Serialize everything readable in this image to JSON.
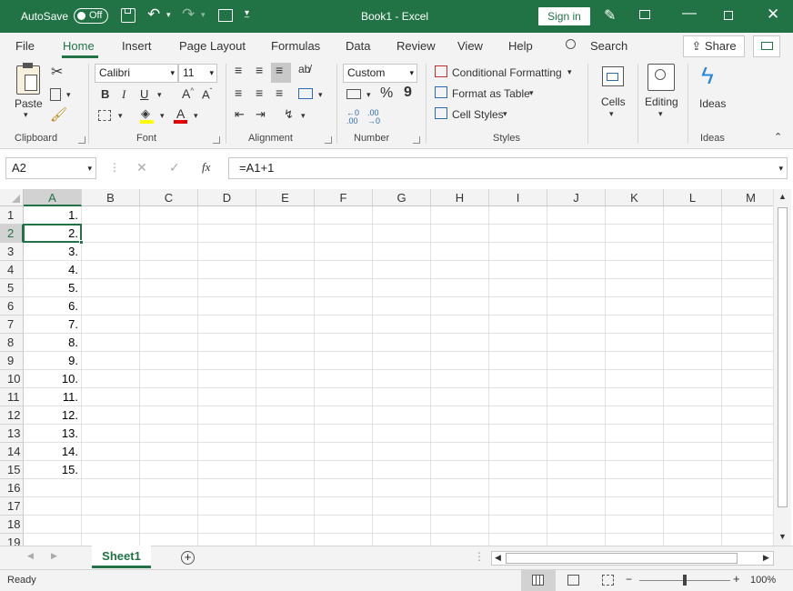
{
  "title_bar": {
    "autosave_label": "AutoSave",
    "autosave_state": "Off",
    "document_title": "Book1 - Excel",
    "sign_in_label": "Sign in"
  },
  "tabs": [
    "File",
    "Home",
    "Insert",
    "Page Layout",
    "Formulas",
    "Data",
    "Review",
    "View",
    "Help"
  ],
  "search_label": "Search",
  "share_label": "Share",
  "ribbon": {
    "clipboard": {
      "paste_label": "Paste",
      "group_label": "Clipboard"
    },
    "font": {
      "font_name": "Calibri",
      "font_size": "11",
      "group_label": "Font",
      "bold": "B",
      "italic": "I",
      "underline": "U"
    },
    "alignment": {
      "group_label": "Alignment"
    },
    "number": {
      "format": "Custom",
      "group_label": "Number",
      "percent": "%",
      "comma": "9"
    },
    "styles": {
      "conditional_formatting": "Conditional Formatting",
      "format_as_table": "Format as Table",
      "cell_styles": "Cell Styles",
      "group_label": "Styles"
    },
    "cells": {
      "label": "Cells"
    },
    "editing": {
      "label": "Editing"
    },
    "ideas": {
      "label": "Ideas",
      "group_label": "Ideas"
    }
  },
  "formula_bar": {
    "name_box": "A2",
    "fx": "fx",
    "formula": "=A1+1"
  },
  "columns": [
    "A",
    "B",
    "C",
    "D",
    "E",
    "F",
    "G",
    "H",
    "I",
    "J",
    "K",
    "L",
    "M"
  ],
  "selected_column": "A",
  "rows": [
    "1",
    "2",
    "3",
    "4",
    "5",
    "6",
    "7",
    "8",
    "9",
    "10",
    "11",
    "12",
    "13",
    "14",
    "15",
    "16",
    "17",
    "18",
    "19"
  ],
  "selected_row": "2",
  "column_a_values": [
    "1.",
    "2.",
    "3.",
    "4.",
    "5.",
    "6.",
    "7.",
    "8.",
    "9.",
    "10.",
    "11.",
    "12.",
    "13.",
    "14.",
    "15."
  ],
  "sheet_tab": "Sheet1",
  "status": {
    "ready": "Ready",
    "zoom": "100%"
  },
  "colors": {
    "brand": "#217346",
    "ribbon_bg": "#f3f3f3"
  }
}
